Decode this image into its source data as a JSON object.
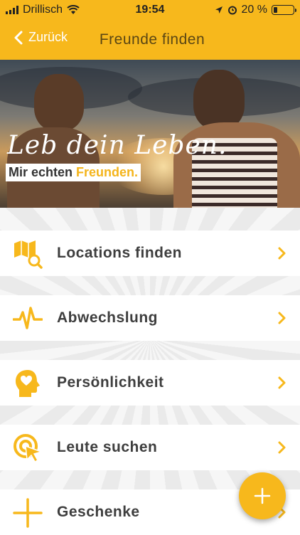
{
  "status_bar": {
    "carrier": "Drillisch",
    "time": "19:54",
    "battery_text": "20 %",
    "battery_level": 0.2
  },
  "navbar": {
    "back_label": "Zurück",
    "title": "Freunde finden"
  },
  "hero": {
    "headline": "Leb dein Leben.",
    "sub_prefix": "Mir echten ",
    "sub_highlight": "Freunden."
  },
  "menu": {
    "items": [
      {
        "label": "Locations finden",
        "icon": "map-search-icon"
      },
      {
        "label": "Abwechslung",
        "icon": "pulse-icon"
      },
      {
        "label": "Persönlichkeit",
        "icon": "head-heart-icon"
      },
      {
        "label": "Leute suchen",
        "icon": "target-cursor-icon"
      },
      {
        "label": "Geschenke",
        "icon": "plus-cross-icon"
      }
    ]
  },
  "fab": {
    "icon": "plus-icon"
  },
  "colors": {
    "accent": "#f7b81c",
    "title_text": "#5a4614",
    "label_text": "#3e3e3e"
  }
}
